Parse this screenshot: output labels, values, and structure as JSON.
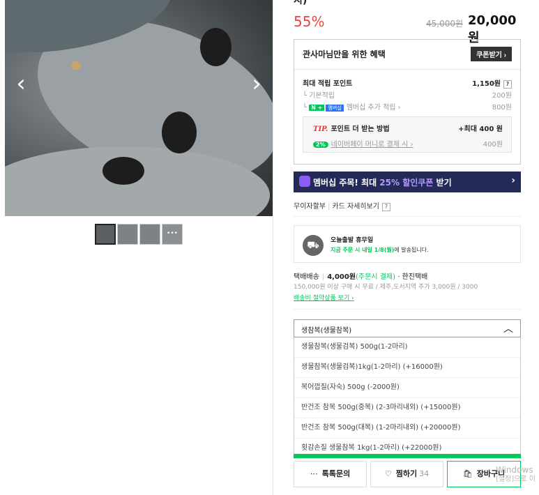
{
  "gallery": {
    "prev_arrow": "‹",
    "next_arrow": "›",
    "more_icon_glyph": "•••"
  },
  "product": {
    "title_fragment": "시)",
    "discount": "55%",
    "original_price": "45,000원",
    "price": "20,000원"
  },
  "benefit": {
    "heading": "관사마님만을 위한 혜택",
    "coupon_button": "쿠폰받기 ›",
    "max_points_label": "최대 적립 포인트",
    "max_points_value": "1,150원",
    "basic_label": "기본적립",
    "basic_value": "200원",
    "membership_badge_n": "N +",
    "membership_badge": "멤버십",
    "membership_label": "멤버십 추가 적립 ›",
    "membership_value": "800원",
    "tip_prefix": "TIP.",
    "tip_label": "포인트 더 받는 방법",
    "tip_max": "+최대 400 원",
    "tip_badge": "2%",
    "tip_sub": "네이버페이 머니로 결제 시 ›",
    "tip_value": "400원"
  },
  "banner": {
    "text_before": "멤버십 주목! 최대 ",
    "accent": "25% 할인쿠폰",
    "text_after": " 받기",
    "chevron": "›"
  },
  "card": {
    "installment": "무이자할부",
    "detail": "카드 자세히보기",
    "q": "?"
  },
  "shipping": {
    "title": "오늘출발 휴무일",
    "highlight": "지금 주문 시 내일 1/8(월)",
    "rest": "에 발송됩니다."
  },
  "delivery": {
    "type": "택배배송",
    "fee": "4,000원",
    "fee_note": "(주문시 결제)",
    "carrier": " · 한진택배",
    "condition": "150,000원 이상 구매 시 무료 / 제주,도서지역 추가 3,000원 / 3000",
    "link": "배송비 절약상품 보기 ›"
  },
  "options": {
    "selected": "생참복(생물참복)",
    "items": [
      "생물참복(생물검복) 500g(1-2마리)",
      "생물참복(생물검복)1kg(1-2마리) (+16000원)",
      "복어껍질(자숙) 500g (-2000원)",
      "반건조 참복 500g(중복) (2-3마리내외) (+15000원)",
      "반건조 참복 500g(대복) (1-2마리내외) (+20000원)",
      "횟감손질 생물참복 1kg(1-2마리) (+22000원)"
    ]
  },
  "actions": {
    "talk": "톡톡문의",
    "wish": "찜하기",
    "wish_count": "34",
    "cart": "장바구니"
  },
  "watermark": {
    "line1": "Windows",
    "line2": "[설정]으로 이"
  },
  "colors": {
    "discount": "#f0433b",
    "naver_green": "#03c75a",
    "banner_bg": "#242a58"
  }
}
